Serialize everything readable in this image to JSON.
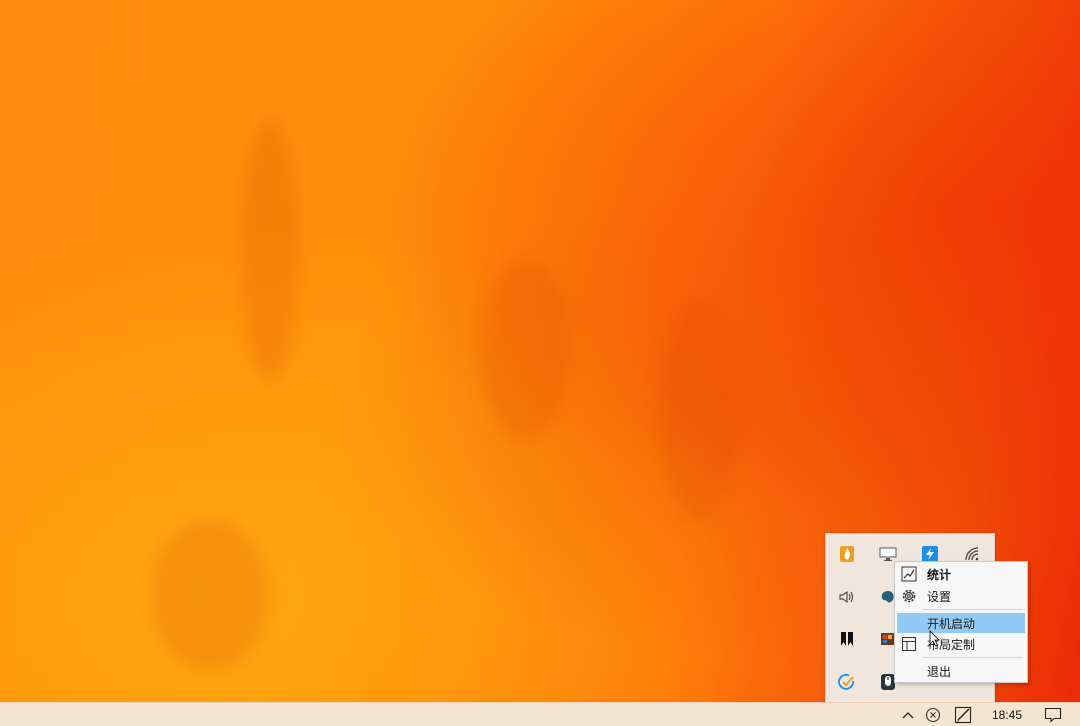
{
  "desktop": {
    "wallpaper_colors": [
      "#ff8a0c",
      "#f24a08",
      "#ea2a06"
    ]
  },
  "tray_overflow": {
    "icons": [
      {
        "name": "flame-app-icon"
      },
      {
        "name": "monitor-app-icon"
      },
      {
        "name": "lightning-app-icon"
      },
      {
        "name": "wifi-icon"
      },
      {
        "name": "speaker-icon"
      },
      {
        "name": "paint-palette-icon"
      },
      {
        "name": "bookmark-app-icon"
      },
      {
        "name": "graphics-card-icon"
      },
      {
        "name": "check-circle-icon"
      },
      {
        "name": "mouse-icon"
      }
    ]
  },
  "context_menu": {
    "items": [
      {
        "label": "统计",
        "icon": "chart-icon",
        "bold": true
      },
      {
        "label": "设置",
        "icon": "gear-icon"
      },
      {
        "label": "开机启动",
        "icon": "",
        "highlighted": true
      },
      {
        "label": "布局定制",
        "icon": "layout-icon"
      },
      {
        "label": "退出",
        "icon": ""
      }
    ],
    "highlight_color": "#91c9f7"
  },
  "taskbar": {
    "clock": "18:45",
    "icons": [
      "chevron-up-icon",
      "close-circle-icon",
      "pen-tablet-icon",
      "notification-icon"
    ],
    "background": "#f5e4d0"
  }
}
